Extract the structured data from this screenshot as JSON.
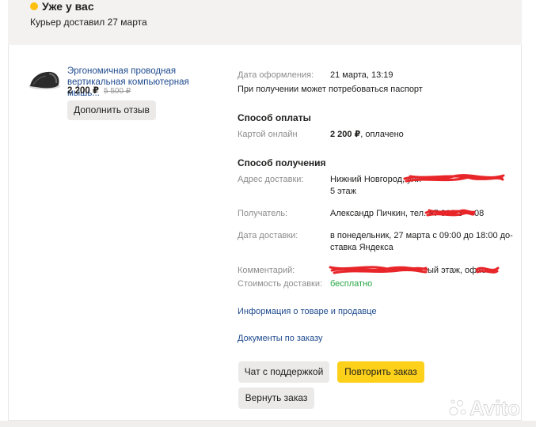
{
  "status": {
    "title": "Уже у вас",
    "subtitle": "Курьер доставил 27 марта",
    "dot_color": "#fdc00f"
  },
  "product": {
    "name": "Эргономичная проводная вертикальная компьютерная мышь...",
    "price": "2 200 ₽",
    "old_price": "5 500 ₽",
    "review_button": "Дополнить отзыв",
    "thumbnail_icon": "vertical-mouse-icon"
  },
  "order": {
    "date_label": "Дата оформления:",
    "date_value": "21 марта, 13:19",
    "passport_note": "При получении может потребоваться паспорт"
  },
  "payment": {
    "heading": "Способ оплаты",
    "method_label": "Картой онлайн",
    "amount": "2 200 ₽",
    "status": ", оплачено"
  },
  "delivery": {
    "heading": "Способ получения",
    "address_label": "Адрес доставки:",
    "address_value": "Нижний Новгород, ули",
    "address_floor": "5 этаж",
    "recipient_label": "Получатель:",
    "recipient_value": "Александр Пичкин, тел. +7 910 3",
    "recipient_tail": "08",
    "delivery_date_label": "Дата доставки:",
    "delivery_date_line1": "в понедельник, 27 марта с 09:00 до 18:00 до-",
    "delivery_date_line2": "ставка Яндекса",
    "comment_label": "Комментарий:",
    "comment_value": "ый этаж, офис",
    "cost_label": "Стоимость доставки:",
    "cost_value": "бесплатно"
  },
  "links": {
    "product_info": "Информация о товаре и продавце",
    "documents": "Документы по заказу"
  },
  "actions": {
    "support": "Чат с поддержкой",
    "repeat": "Повторить заказ",
    "return": "Вернуть заказ"
  },
  "watermark": "Avito",
  "colors": {
    "accent_yellow": "#fdd019",
    "link_blue": "#1f4b8f",
    "success_green": "#28a745",
    "redaction_red": "#e8262a"
  }
}
